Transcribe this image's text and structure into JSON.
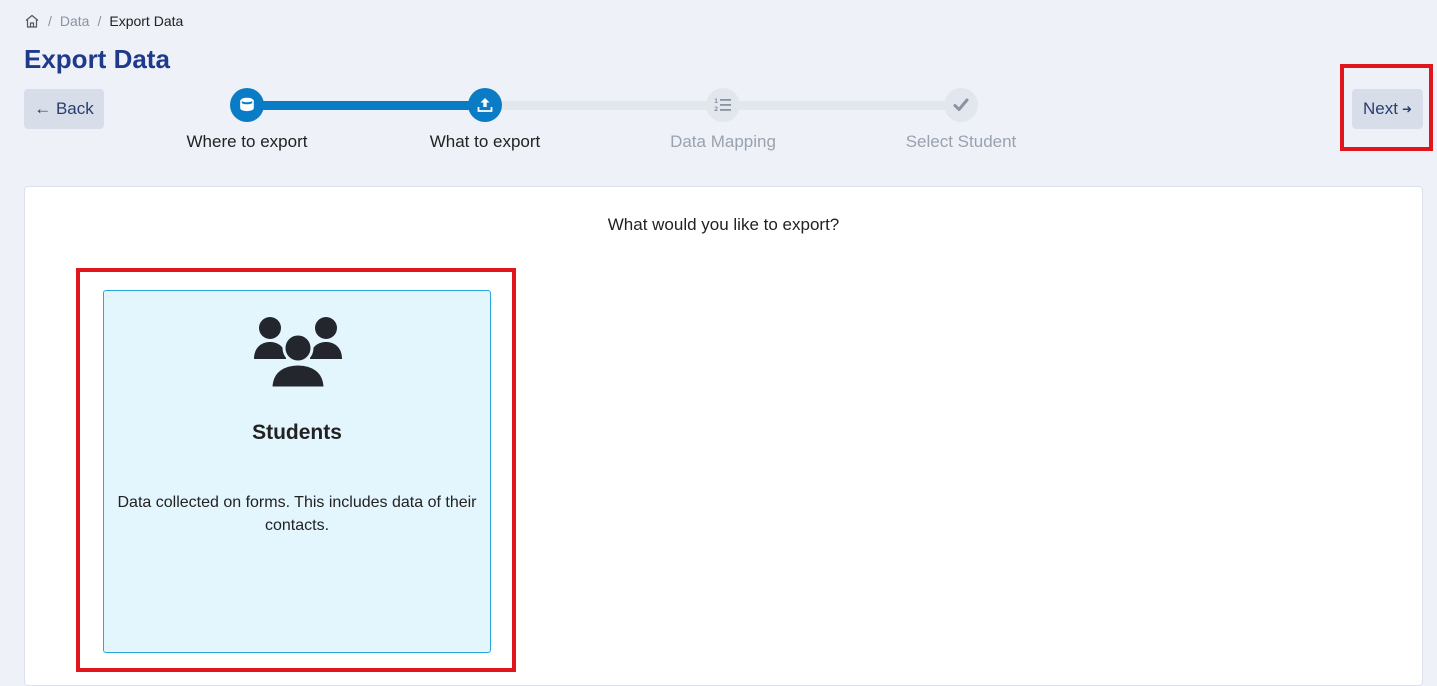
{
  "breadcrumb": {
    "home_icon": "home-icon",
    "items": [
      "Data",
      "Export Data"
    ],
    "separator": "/"
  },
  "page": {
    "title": "Export Data"
  },
  "nav": {
    "back_label": "← Back",
    "next_label": "Next",
    "next_arrow": "➜"
  },
  "stepper": {
    "steps": [
      {
        "label": "Where to export",
        "icon": "database-icon",
        "state": "completed"
      },
      {
        "label": "What to export",
        "icon": "upload-icon",
        "state": "active"
      },
      {
        "label": "Data Mapping",
        "icon": "numbered-list-icon",
        "state": "pending"
      },
      {
        "label": "Select Student",
        "icon": "check-icon",
        "state": "pending"
      }
    ],
    "progress_fraction": 0.333
  },
  "main": {
    "prompt": "What would you like to export?",
    "options": [
      {
        "icon": "users-icon",
        "title": "Students",
        "description": "Data collected on forms. This includes data of their contacts.",
        "selected": true
      }
    ]
  },
  "colors": {
    "accent": "#0a7cc6",
    "title": "#1f3a8a",
    "highlight": "#e0161c",
    "selected_card_bg": "#e3f5fd"
  }
}
